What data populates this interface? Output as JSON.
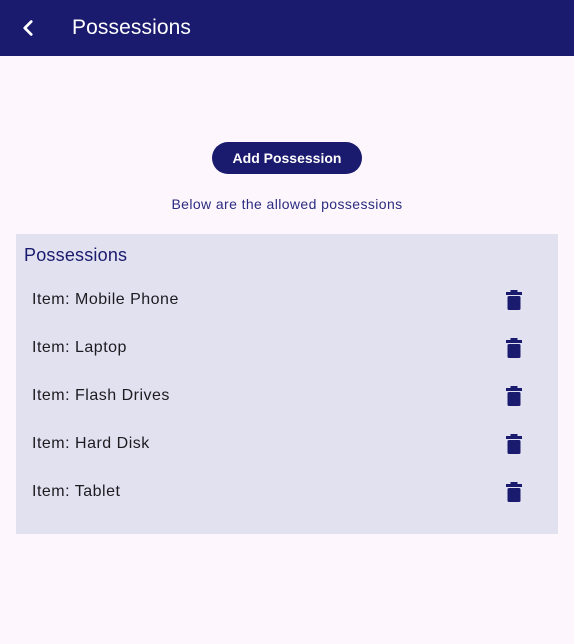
{
  "app_bar": {
    "title": "Possessions",
    "back_icon": "chevron-left-icon",
    "background": "#1a1a6e"
  },
  "actions": {
    "add_label": "Add Possession"
  },
  "info": {
    "subtitle": "Below are the allowed possessions"
  },
  "panel": {
    "title": "Possessions",
    "items": [
      {
        "label": "Item: Mobile Phone",
        "icon": "trash-icon"
      },
      {
        "label": "Item: Laptop",
        "icon": "trash-icon"
      },
      {
        "label": "Item: Flash Drives",
        "icon": "trash-icon"
      },
      {
        "label": "Item: Hard Disk",
        "icon": "trash-icon"
      },
      {
        "label": "Item: Tablet",
        "icon": "trash-icon"
      }
    ]
  },
  "colors": {
    "primary": "#1a1a6e",
    "page_background": "#fdf7fd",
    "panel_background": "#e2e1f0"
  }
}
